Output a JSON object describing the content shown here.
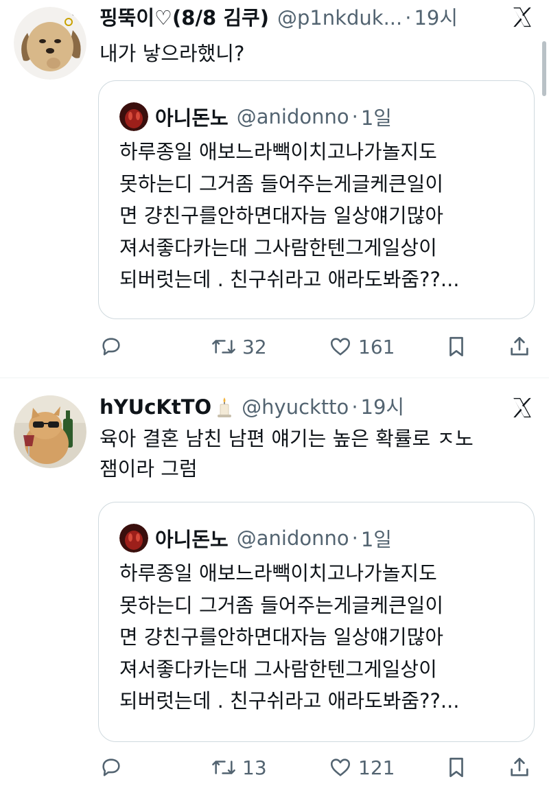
{
  "tweets": [
    {
      "name": "핑뚝이♡(8/8 김쿠)",
      "handle": "@p1nkduk...",
      "dot": "·",
      "time": "19시",
      "text": "내가 낳으라했니?",
      "avatar_icon": "puppy-avatar",
      "quote": {
        "name": "아니돈노",
        "handle": "@anidonno",
        "dot": "·",
        "time": "1일",
        "text": "하루종일 애보느라빽이치고나가놀지도\n못하는디 그거좀 들어주는게글케큰일이\n면 걍친구를안하면대자늠 일상얘기많아\n져서좋다카는대 그사람한텐그게일상이\n되버럿는데 . 친구쉬라고 애라도봐줌??..."
      },
      "actions": {
        "reply_count": "",
        "retweet_count": "32",
        "like_count": "161"
      }
    },
    {
      "name": "hYUcKtTO",
      "handle": "@hyucktto",
      "dot": "·",
      "time": "19시",
      "text": "육아 결혼 남친 남편 얘기는 높은 확률로 ㅈ노\n잼이라 그럼",
      "avatar_icon": "cat-sunglasses-avatar",
      "quote": {
        "name": "아니돈노",
        "handle": "@anidonno",
        "dot": "·",
        "time": "1일",
        "text": "하루종일 애보느라빽이치고나가놀지도\n못하는디 그거좀 들어주는게글케큰일이\n면 걍친구를안하면대자늠 일상얘기많아\n져서좋다카는대 그사람한텐그게일상이\n되버럿는데 . 친구쉬라고 애라도봐줌??..."
      },
      "actions": {
        "reply_count": "",
        "retweet_count": "13",
        "like_count": "121"
      }
    }
  ],
  "icons": {
    "x_logo": "x-logo-icon",
    "reply": "reply-icon",
    "retweet": "retweet-icon",
    "like": "heart-icon",
    "bookmark": "bookmark-icon",
    "share": "share-icon",
    "candle": "candle-emoji"
  },
  "colors": {
    "text": "#0f1419",
    "secondary": "#536471",
    "border": "#cfd9de",
    "divider": "#eff3f4"
  }
}
